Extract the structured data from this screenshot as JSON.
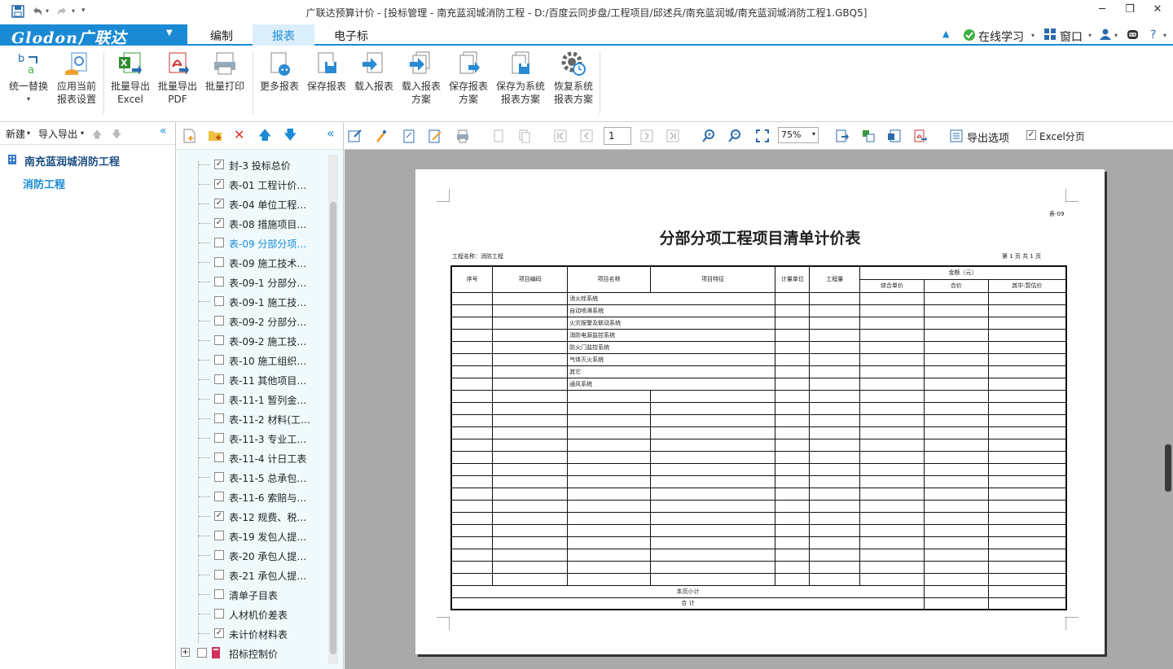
{
  "window": {
    "title": "广联达预算计价 - [投标管理 - 南充蓝润城消防工程 - D:/百度云同步盘/工程项目/邱述兵/南充蓝润城/南充蓝润城消防工程1.GBQ5]"
  },
  "menubar": {
    "brand": "Glodon广联达",
    "tabs": [
      "编制",
      "报表",
      "电子标"
    ],
    "online": "在线学习",
    "window_menu": "窗口"
  },
  "ribbon": {
    "buttons": [
      {
        "line1": "统一替换",
        "line2": ""
      },
      {
        "line1": "应用当前",
        "line2": "报表设置"
      },
      {
        "line1": "批量导出",
        "line2": "Excel"
      },
      {
        "line1": "批量导出",
        "line2": "PDF"
      },
      {
        "line1": "批量打印",
        "line2": ""
      },
      {
        "line1": "更多报表",
        "line2": ""
      },
      {
        "line1": "保存报表",
        "line2": ""
      },
      {
        "line1": "载入报表",
        "line2": ""
      },
      {
        "line1": "载入报表",
        "line2": "方案"
      },
      {
        "line1": "保存报表",
        "line2": "方案"
      },
      {
        "line1": "保存为系统",
        "line2": "报表方案"
      },
      {
        "line1": "恢复系统",
        "line2": "报表方案"
      }
    ]
  },
  "left_panel": {
    "new": "新建",
    "import_export": "导入导出",
    "root": "南充蓝润城消防工程",
    "child": "消防工程"
  },
  "report_list": {
    "items": [
      {
        "label": "封-3 投标总价",
        "checked": true
      },
      {
        "label": "表-01 工程计价…",
        "checked": true
      },
      {
        "label": "表-04 单位工程…",
        "checked": true
      },
      {
        "label": "表-08 措施项目…",
        "checked": true
      },
      {
        "label": "表-09 分部分项…",
        "checked": false,
        "selected": true
      },
      {
        "label": "表-09 施工技术…",
        "checked": false
      },
      {
        "label": "表-09-1 分部分…",
        "checked": false
      },
      {
        "label": "表-09-1 施工技…",
        "checked": false
      },
      {
        "label": "表-09-2 分部分…",
        "checked": false
      },
      {
        "label": "表-09-2 施工技…",
        "checked": false
      },
      {
        "label": "表-10 施工组织…",
        "checked": false
      },
      {
        "label": "表-11 其他项目…",
        "checked": false
      },
      {
        "label": "表-11-1 暂列金…",
        "checked": false
      },
      {
        "label": "表-11-2 材料(工…",
        "checked": false
      },
      {
        "label": "表-11-3 专业工…",
        "checked": false
      },
      {
        "label": "表-11-4 计日工表",
        "checked": false
      },
      {
        "label": "表-11-5 总承包…",
        "checked": false
      },
      {
        "label": "表-11-6 索赔与…",
        "checked": false
      },
      {
        "label": "表-12 规费、税…",
        "checked": true
      },
      {
        "label": "表-19 发包人提…",
        "checked": false
      },
      {
        "label": "表-20 承包人提…",
        "checked": false
      },
      {
        "label": "表-21 承包人提…",
        "checked": false
      },
      {
        "label": "清单子目表",
        "checked": false
      },
      {
        "label": "人材机价差表",
        "checked": false
      },
      {
        "label": "未计价材料表",
        "checked": true
      }
    ],
    "group": "招标控制价"
  },
  "preview_toolbar": {
    "page": "1",
    "zoom": "75%",
    "export_options": "导出选项",
    "excel_split": "Excel分页"
  },
  "report": {
    "code": "表-09",
    "title": "分部分项工程项目清单计价表",
    "project_label": "工程名称：消防工程",
    "page_info": "第 1 页 共 1 页",
    "headers": {
      "seq": "序号",
      "code": "项目编码",
      "name": "项目名称",
      "feature": "项目特征",
      "unit": "计量单位",
      "qty": "工程量",
      "amount": "金额（元）",
      "unit_price": "综合单价",
      "total": "合价",
      "provisional": "其中:暂估价"
    },
    "rows": [
      "消火栓系统",
      "自动喷淋系统",
      "火灾报警及联动系统",
      "消防电源监控系统",
      "防火门监控系统",
      "气体灭火系统",
      "其它",
      "通风系统"
    ],
    "empty_rows": 16,
    "subtotal": "本页小计",
    "total": "合  计"
  }
}
